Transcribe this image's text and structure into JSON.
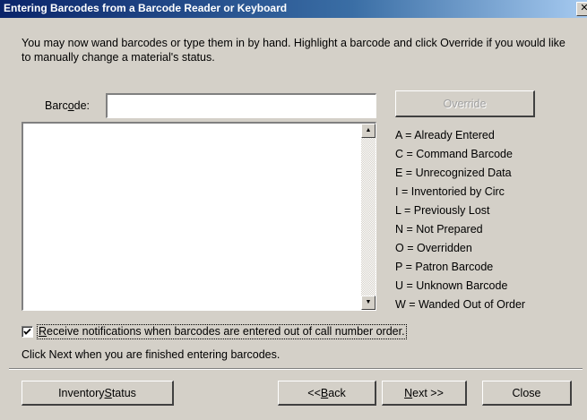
{
  "window": {
    "title": "Entering Barcodes from a Barcode Reader or Keyboard",
    "close_glyph": "✕"
  },
  "intro_text": "You may now wand barcodes or type them in by hand.  Highlight a barcode and click Override if you would like to manually change a material's status.",
  "barcode": {
    "label_pre": "Barc",
    "label_accel": "o",
    "label_post": "de:",
    "value": ""
  },
  "override_button": {
    "label": "Override",
    "enabled": false
  },
  "listbox": {
    "items": []
  },
  "legend": [
    "A = Already Entered",
    "C = Command Barcode",
    "E = Unrecognized Data",
    "I = Inventoried by Circ",
    "L = Previously Lost",
    "N = Not Prepared",
    "O = Overridden",
    "P = Patron Barcode",
    "U = Unknown Barcode",
    "W = Wanded Out of Order"
  ],
  "notifications": {
    "checked": true,
    "label_accel": "R",
    "label_rest": "eceive notifications when barcodes are entered out of call number order."
  },
  "hint_text": "Click Next when you are finished entering barcodes.",
  "buttons": {
    "inventory_status": {
      "pre": "Inventory ",
      "accel": "S",
      "post": "tatus"
    },
    "back": {
      "pre": "<< ",
      "accel": "B",
      "post": "ack"
    },
    "next": {
      "pre": "",
      "accel": "N",
      "post": "ext >>"
    },
    "close": {
      "pre": "Close",
      "accel": "",
      "post": ""
    }
  },
  "colors": {
    "titlebar_start": "#0a246a",
    "titlebar_end": "#a6caf0",
    "dialog_face": "#d4d0c8"
  }
}
